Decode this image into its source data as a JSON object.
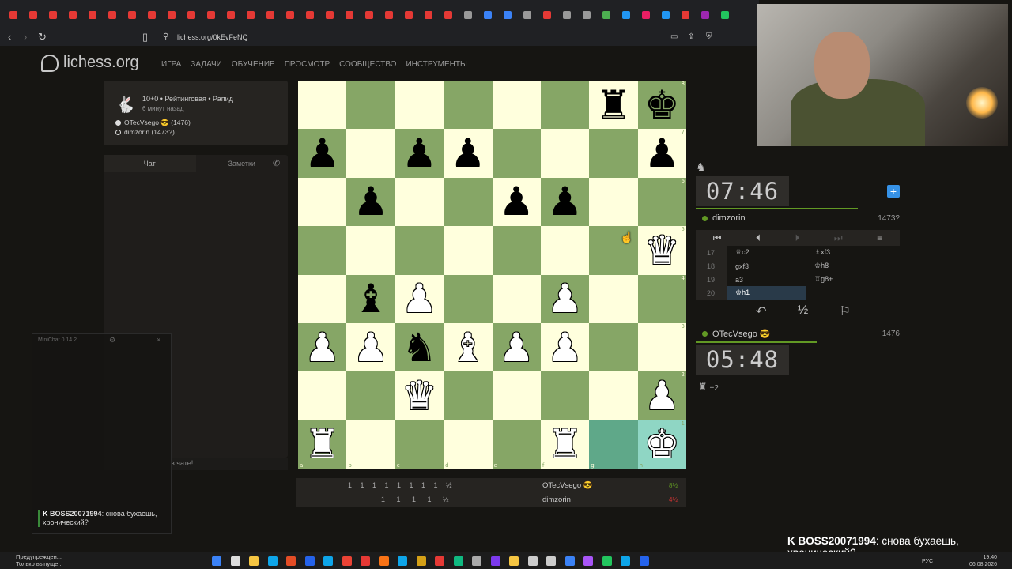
{
  "browser": {
    "url": "lichess.org/0kEvFeNQ"
  },
  "site": {
    "logo": "lichess.org",
    "nav": [
      "ИГРА",
      "ЗАДАЧИ",
      "ОБУЧЕНИЕ",
      "ПРОСМОТР",
      "СООБЩЕСТВО",
      "ИНСТРУМЕНТЫ"
    ]
  },
  "game_info": {
    "line1": "10+0 • Рейтинговая • Рапид",
    "line2": "6 минут назад",
    "white": "OTecVsego 😎 (1476)",
    "black": "dimzorin (1473?)"
  },
  "chat": {
    "tab_chat": "Чат",
    "tab_notes": "Заметки",
    "input_tail": "в чате!"
  },
  "minichat": {
    "title": "MiniChat 0.14.2",
    "user": "BOSS20071994",
    "message": ": снова бухаешь, хронический?"
  },
  "board": {
    "files": [
      "a",
      "b",
      "c",
      "d",
      "e",
      "f",
      "g",
      "h"
    ],
    "ranks": [
      "8",
      "7",
      "6",
      "5",
      "4",
      "3",
      "2",
      "1"
    ],
    "position": [
      [
        "",
        "",
        "",
        "",
        "",
        "",
        "br",
        "bk"
      ],
      [
        "bp",
        "",
        "bp",
        "bp",
        "",
        "",
        "",
        "bp"
      ],
      [
        "",
        "bp",
        "",
        "",
        "bp",
        "bp",
        "",
        ""
      ],
      [
        "",
        "",
        "",
        "",
        "",
        "",
        "",
        "wq"
      ],
      [
        "",
        "bb",
        "wp",
        "",
        "",
        "wp",
        "",
        ""
      ],
      [
        "wp",
        "wp",
        "bn",
        "wb",
        "wp",
        "wp",
        "",
        ""
      ],
      [
        "",
        "",
        "wq",
        "",
        "",
        "",
        "",
        "wp"
      ],
      [
        "wr",
        "",
        "",
        "",
        "",
        "wr",
        "",
        "wk"
      ]
    ],
    "highlight": [
      "g1",
      "h1"
    ]
  },
  "crosstable": {
    "row1": "1 1 1 1 1 1 1 1 ½",
    "row2": "1 1 1 1 ½",
    "player1": "OTecVsego 😎",
    "player1_score": "8½",
    "player2": "dimzorin",
    "player2_score": "4½"
  },
  "clocks": {
    "top": "07:46",
    "bottom": "05:48"
  },
  "players": {
    "top_name": "dimzorin",
    "top_rating": "1473?",
    "bottom_name": "OTecVsego 😎",
    "bottom_rating": "1476"
  },
  "moves": [
    {
      "num": "17",
      "white": "♕c2",
      "black": "♗xf3"
    },
    {
      "num": "18",
      "white": "gxf3",
      "black": "♔h8"
    },
    {
      "num": "19",
      "white": "a3",
      "black": "♖g8+"
    },
    {
      "num": "20",
      "white": "♔h1",
      "black": ""
    }
  ],
  "controls": {
    "draw": "½"
  },
  "material": {
    "diff": "+2"
  },
  "overlay": {
    "user": "BOSS20071994",
    "message": ": снова бухаешь, хронический?"
  },
  "taskbar": {
    "notif_line1": "Предупрежден...",
    "notif_line2": "Только выпуще...",
    "lang": "РУС",
    "time": "19:40",
    "date": "06.08.2026"
  },
  "colors": {
    "board_light": "#ffffdd",
    "board_dark": "#86a666",
    "accent_green": "#629924",
    "lichess_bg": "#161512"
  }
}
